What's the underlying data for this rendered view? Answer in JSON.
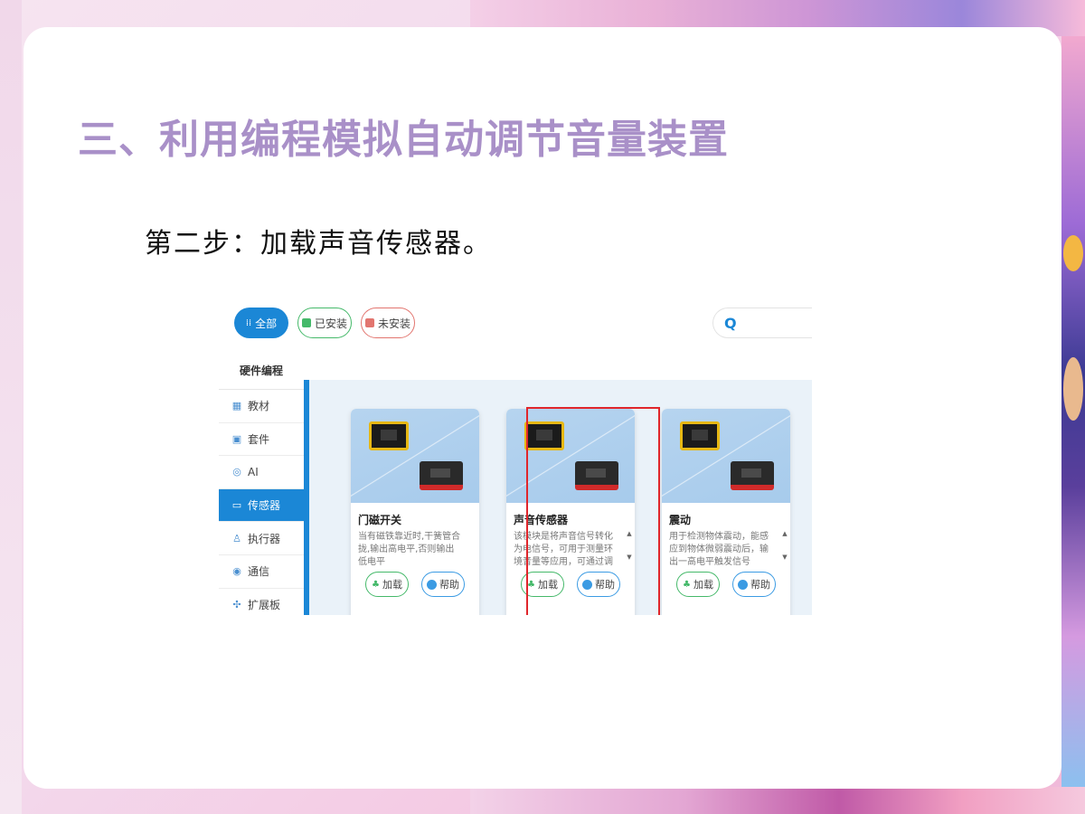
{
  "slide": {
    "title": "三、利用编程模拟自动调节音量装置",
    "subtitle": "第二步：加载声音传感器。"
  },
  "toolbar": {
    "filters": [
      {
        "label": "全部",
        "icon": "grid-icon",
        "active": true
      },
      {
        "label": "已安装",
        "icon": "installed-tag-icon"
      },
      {
        "label": "未安装",
        "icon": "uninstalled-tag-icon"
      }
    ],
    "search_icon": "Q"
  },
  "sidebar": {
    "header": "硬件编程",
    "items": [
      {
        "label": "教材",
        "icon": "grid-icon",
        "glyph": "▦"
      },
      {
        "label": "套件",
        "icon": "kit-icon",
        "glyph": "▣"
      },
      {
        "label": "AI",
        "icon": "ai-icon",
        "glyph": "◎"
      },
      {
        "label": "传感器",
        "icon": "sensor-icon",
        "glyph": "▭",
        "active": true
      },
      {
        "label": "执行器",
        "icon": "actuator-icon",
        "glyph": "♙"
      },
      {
        "label": "通信",
        "icon": "communication-icon",
        "glyph": "◉"
      },
      {
        "label": "扩展板",
        "icon": "expansion-icon",
        "glyph": "✣"
      }
    ]
  },
  "cards": [
    {
      "title": "门磁开关",
      "description": "当有磁铁靠近时,干簧管合拢,输出高电平,否则输出低电平",
      "load_label": "加载",
      "help_label": "帮助"
    },
    {
      "title": "声音传感器",
      "description": "该模块是将声音信号转化为电信号，可用于测量环境音量等应用，可通过调节可调电位",
      "load_label": "加载",
      "help_label": "帮助",
      "highlighted": true
    },
    {
      "title": "震动",
      "description": "用于检测物体震动，能感应到物体微弱震动后，输出一高电平触发信号",
      "load_label": "加载",
      "help_label": "帮助"
    }
  ],
  "colors": {
    "title": "#a990c8",
    "accent": "#1b87d6",
    "load_border": "#45b96a",
    "help_border": "#3b9be3",
    "highlight": "#e0262b"
  }
}
